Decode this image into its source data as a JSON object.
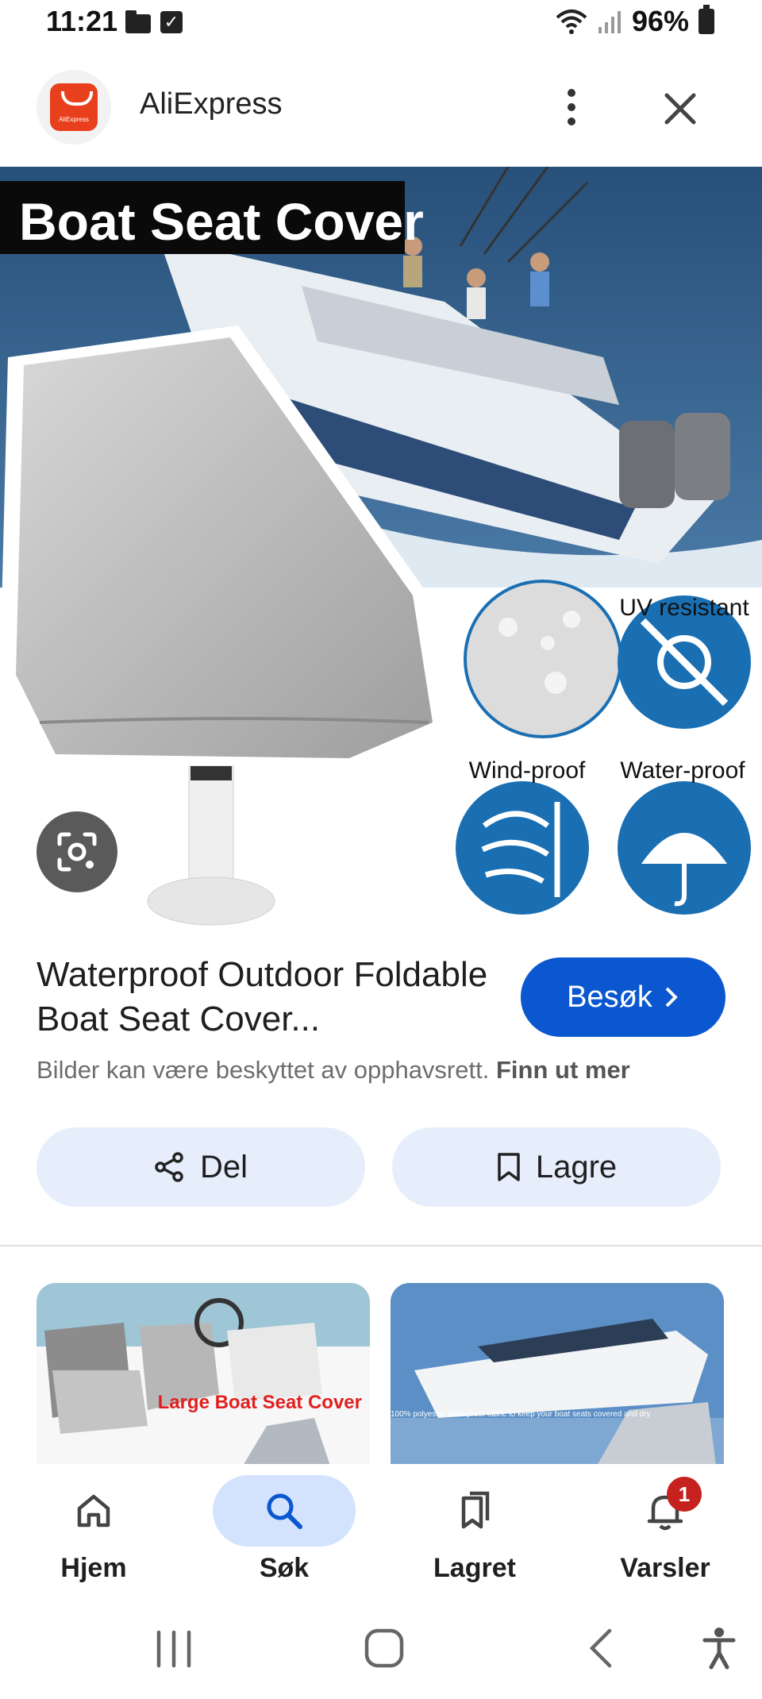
{
  "status_bar": {
    "time": "11:21",
    "battery": "96%"
  },
  "header": {
    "app_name": "AliExpress",
    "logo_text": "AliExpress"
  },
  "image": {
    "banner": "Boat Seat Cover",
    "features": [
      "UV resistant",
      "Wind-proof",
      "Water-proof"
    ]
  },
  "product": {
    "title": "Waterproof Outdoor Foldable Boat Seat Cover...",
    "visit_label": "Besøk",
    "copyright_text": "Bilder kan være beskyttet av opphavsrett.",
    "learn_more": "Finn ut mer"
  },
  "actions": {
    "share_label": "Del",
    "save_label": "Lagre"
  },
  "related": [
    {
      "caption": "Large Boat Seat Cover"
    },
    {
      "caption": "100% polyester waterproof fabric to keep your boat seats covered and dry"
    }
  ],
  "bottom_nav": [
    {
      "label": "Hjem",
      "icon": "home-icon"
    },
    {
      "label": "Søk",
      "icon": "search-icon",
      "active": true
    },
    {
      "label": "Lagret",
      "icon": "bookmarks-icon"
    },
    {
      "label": "Varsler",
      "icon": "bell-icon",
      "badge": "1"
    }
  ]
}
